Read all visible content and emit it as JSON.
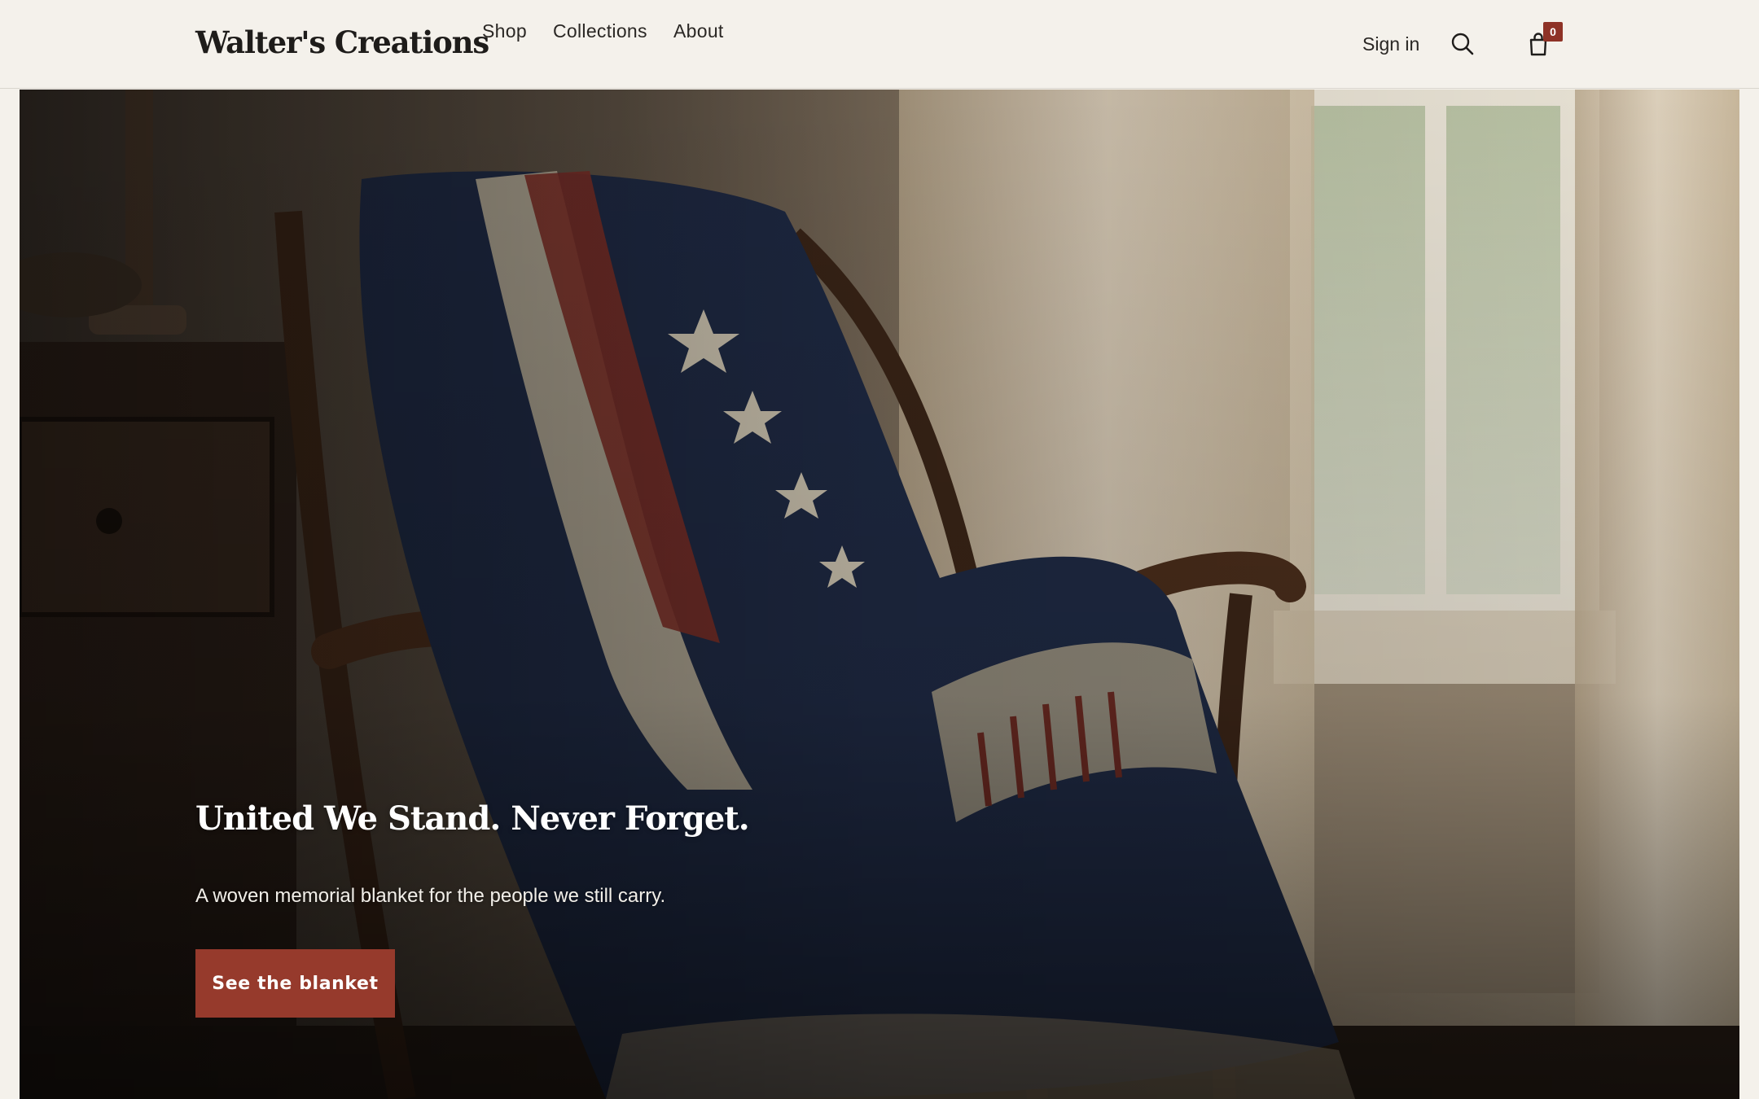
{
  "header": {
    "logo": "Walter's Creations",
    "nav": [
      "Shop",
      "Collections",
      "About"
    ],
    "sign_in": "Sign in",
    "search_icon": "search-icon",
    "cart_icon": "shopping-bag-icon",
    "cart_count": "0"
  },
  "hero": {
    "title": "United We Stand. Never Forget.",
    "subtitle": "A woven memorial blanket for the people we still carry.",
    "cta_label": "See the blanket",
    "image": "photo of a navy, red and cream woven flag blanket draped over a wooden rocking chair beside a sheer-curtained window"
  },
  "colors": {
    "background": "#f4f1eb",
    "accent": "#963a2c",
    "badge": "#8e3226",
    "text": "#1e1c1a"
  }
}
